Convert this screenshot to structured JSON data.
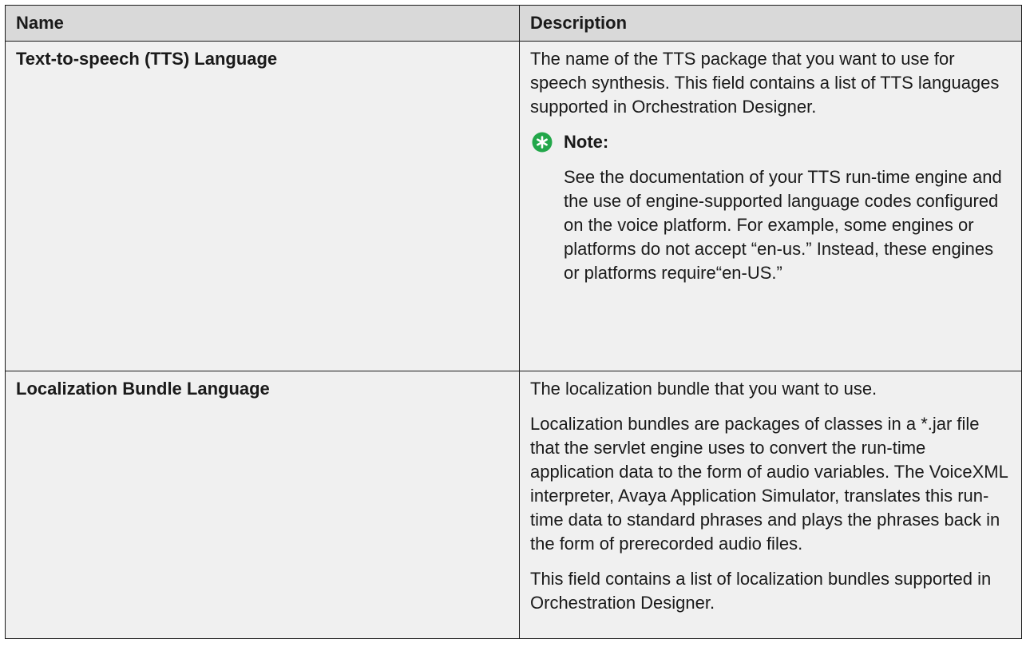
{
  "table": {
    "headers": {
      "name": "Name",
      "description": "Description"
    },
    "rows": [
      {
        "name": "Text-to-speech (TTS) Language",
        "paragraphs": [
          "The name of the TTS package that you want to use for speech synthesis. This field contains a list of TTS languages supported in Orchestration Designer."
        ],
        "note": {
          "label": "Note:",
          "icon": "asterisk-note-icon",
          "icon_color": "#22a74a",
          "text": "See the documentation of your TTS run-time engine and the use of engine-supported language codes configured on the voice platform. For example, some engines or platforms do not accept “en-us.” Instead, these engines or platforms require“en-US.”"
        }
      },
      {
        "name": "Localization Bundle Language",
        "paragraphs": [
          "The localization bundle that you want to use.",
          "Localization bundles are packages of classes in a *.jar file that the servlet engine uses to convert the run-time application data to the form of audio variables. The VoiceXML interpreter, Avaya Application Simulator, translates this run-time data to standard phrases and plays the phrases back in the form of prerecorded audio files.",
          "This field contains a list of localization bundles supported in Orchestration Designer."
        ]
      }
    ]
  },
  "colors": {
    "header_bg": "#d9d9d9",
    "cell_bg": "#f0f0f0",
    "border": "#1a1a1a",
    "note_icon": "#22a74a"
  }
}
